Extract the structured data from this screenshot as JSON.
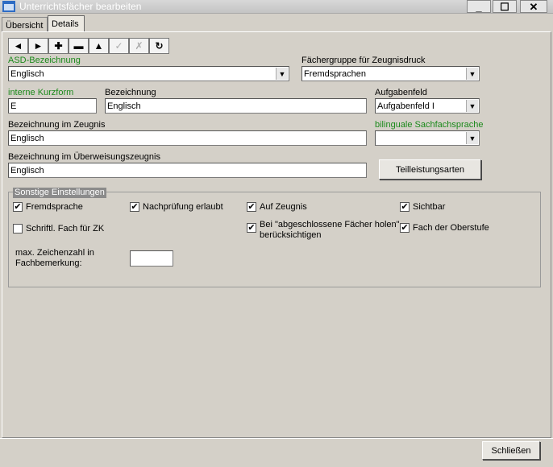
{
  "window": {
    "title": "Unterrichtsfächer bearbeiten",
    "minimize": "_",
    "maximize": "☐",
    "close": "✕"
  },
  "tabs": [
    {
      "label": "Übersicht"
    },
    {
      "label": "Details"
    }
  ],
  "toolbar": {
    "buttons": [
      {
        "icon": "◄",
        "name": "prev-record"
      },
      {
        "icon": "►",
        "name": "next-record"
      },
      {
        "icon": "✚",
        "name": "add-record"
      },
      {
        "icon": "▬",
        "name": "delete-record"
      },
      {
        "icon": "▲",
        "name": "move-up"
      },
      {
        "icon": "✓",
        "name": "save-record"
      },
      {
        "icon": "✗",
        "name": "cancel-record"
      },
      {
        "icon": "↻",
        "name": "refresh"
      }
    ]
  },
  "form": {
    "asd_label": "ASD-Bezeichnung",
    "asd_value": "Englisch",
    "faechergruppe_label": "Fächergruppe für Zeugnisdruck",
    "faechergruppe_value": "Fremdsprachen",
    "kurzform_label": "interne Kurzform",
    "kurzform_value": "E",
    "bezeichnung_label": "Bezeichnung",
    "bezeichnung_value": "Englisch",
    "aufgabenfeld_label": "Aufgabenfeld",
    "aufgabenfeld_value": "Aufgabenfeld I",
    "zeugnis_label": "Bezeichnung im Zeugnis",
    "zeugnis_value": "Englisch",
    "bilingual_label": "bilinguale Sachfachsprache",
    "bilingual_value": "",
    "ueberweisung_label": "Bezeichnung im Überweisungszeugnis",
    "ueberweisung_value": "Englisch",
    "teilleistung_button": "Teilleistungsarten"
  },
  "settings": {
    "title": "Sonstige Einstellungen",
    "fremdsprache": {
      "label": "Fremdsprache",
      "mark": "✔"
    },
    "nachpruefung": {
      "label": "Nachprüfung erlaubt",
      "mark": "✔"
    },
    "auf_zeugnis": {
      "label": "Auf Zeugnis",
      "mark": "✔"
    },
    "sichtbar": {
      "label": "Sichtbar",
      "mark": "✔"
    },
    "schriftl_zk": {
      "label": "Schriftl. Fach für ZK",
      "mark": ""
    },
    "abgeschlossen": {
      "label_line1": "Bei \"abgeschlossene Fächer holen\"",
      "label_line2": "berücksichtigen",
      "mark": "✔"
    },
    "oberstufe": {
      "label": "Fach der Oberstufe",
      "mark": "✔"
    },
    "max_zeichen_line1": "max. Zeichenzahl in",
    "max_zeichen_line2": "Fachbemerkung:",
    "max_zeichen_value": ""
  },
  "footer": {
    "close_button": "Schließen"
  }
}
